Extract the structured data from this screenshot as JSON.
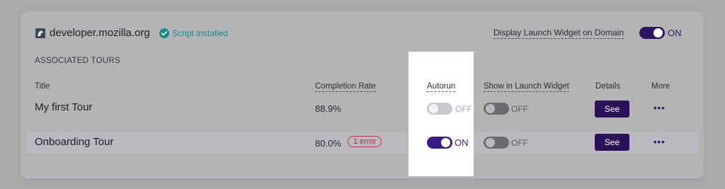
{
  "site": {
    "domain": "developer.mozilla.org",
    "status": "Script Installed",
    "launch_widget_label": "Display Launch Widget on Domain",
    "launch_widget_state": "ON"
  },
  "section_title": "ASSOCIATED TOURS",
  "columns": {
    "title": "Title",
    "completion_rate": "Completion Rate",
    "autorun": "Autorun",
    "show_in_launch_widget": "Show in Launch Widget",
    "details": "Details",
    "more": "More"
  },
  "tours": [
    {
      "title": "My first Tour",
      "completion_rate": "88.9%",
      "error_badge": "",
      "autorun": "OFF",
      "show_in_launch_widget": "OFF",
      "details_label": "See",
      "more_label": "•••"
    },
    {
      "title": "Onboarding Tour",
      "completion_rate": "80.0%",
      "error_badge": "1 error",
      "autorun": "ON",
      "show_in_launch_widget": "OFF",
      "details_label": "See",
      "more_label": "•••"
    }
  ],
  "colors": {
    "accent": "#3b1b8a",
    "installed": "#1b8a8a",
    "error": "#b2243a"
  },
  "icons": {
    "domain": "site-favicon-icon",
    "status": "check-circle-icon"
  }
}
